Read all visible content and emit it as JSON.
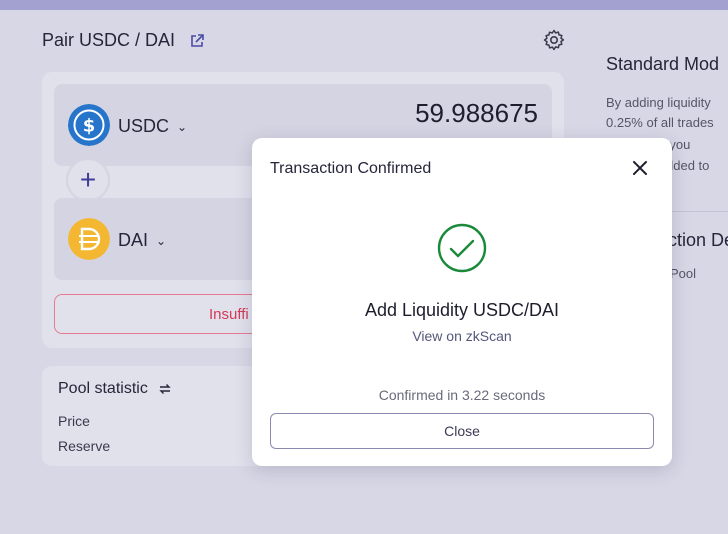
{
  "header": {
    "pair_title": "Pair USDC / DAI",
    "external_link_icon": "external-link-icon",
    "settings_icon": "gear-icon"
  },
  "liquidity_form": {
    "token_a": {
      "symbol": "USDC",
      "amount": "59.988675",
      "icon": "usdc-coin-icon",
      "color": "#2775ca"
    },
    "token_b": {
      "symbol": "DAI",
      "icon": "dai-coin-icon",
      "color": "#f4b731"
    },
    "plus_icon": "plus-icon",
    "submit_label": "Insuffi"
  },
  "pool_statistic": {
    "title": "Pool statistic",
    "swap_icon": "swap-arrows-icon",
    "rows": [
      {
        "label": "Price"
      },
      {
        "label": "Reserve"
      }
    ]
  },
  "right_panel": {
    "title": "Standard Mod",
    "lines": [
      "By adding liquidity",
      "0.25% of all trades",
      "nal to you",
      "dded to"
    ],
    "title2": "ction De",
    "line2": "Pool"
  },
  "modal": {
    "title": "Transaction Confirmed",
    "close_icon": "close-icon",
    "success_icon": "check-circle-icon",
    "heading": "Add Liquidity USDC/DAI",
    "link": "View on zkScan",
    "confirmed_text": "Confirmed in 3.22 seconds",
    "close_button": "Close",
    "accent_color": "#1a8a3a"
  },
  "colors": {
    "topbar": "#a3a1cf",
    "error": "#d43a5a"
  }
}
